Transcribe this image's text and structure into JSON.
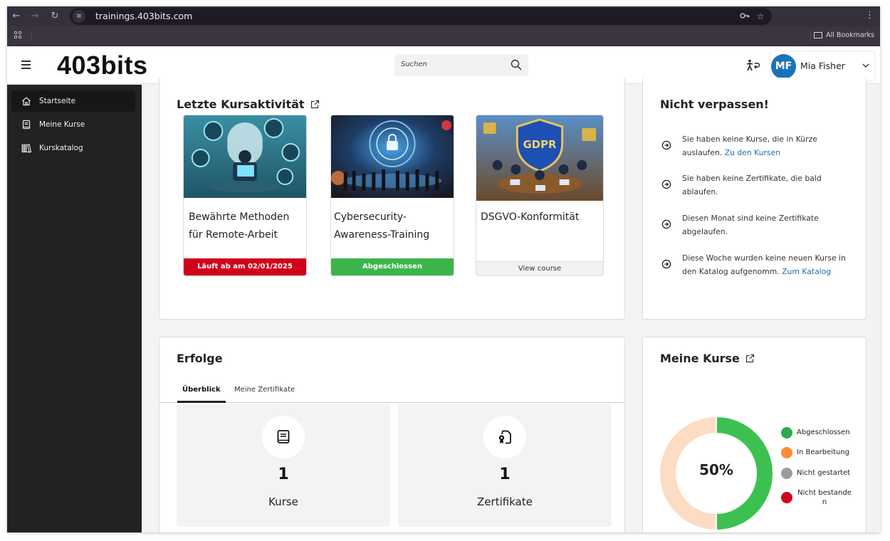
{
  "browser": {
    "url": "trainings.403bits.com",
    "bookmarks_label": "All Bookmarks",
    "icons": [
      "back-icon",
      "forward-icon",
      "reload-icon",
      "site-settings-icon",
      "password-key-icon",
      "bookmark-star-icon",
      "menu-kebab-icon",
      "apps-grid-icon",
      "folder-icon"
    ]
  },
  "header": {
    "logo": "403bits",
    "search_placeholder": "Suchen",
    "user": {
      "initials": "MF",
      "name": "Mia Fisher"
    },
    "colors": {
      "avatar": "#1a73b8"
    }
  },
  "sidebar": {
    "items": [
      {
        "label": "Startseite",
        "icon": "home-icon",
        "active": true
      },
      {
        "label": "Meine Kurse",
        "icon": "book-icon",
        "active": false
      },
      {
        "label": "Kurskatalog",
        "icon": "library-icon",
        "active": false
      }
    ]
  },
  "recent": {
    "title": "Letzte Kursaktivität",
    "courses": [
      {
        "title": "Bewährte Methoden für Remote-Arbeit",
        "status": "Läuft ab am 02/01/2025",
        "status_color": "#d0021b",
        "status_text_color": "#ffffff"
      },
      {
        "title": "Cybersecurity-Awareness-Training",
        "status": "Abgeschlossen",
        "status_color": "#3bb54a",
        "status_text_color": "#ffffff"
      },
      {
        "title": "DSGVO-Konformität",
        "status": "View course",
        "status_color": "#f1f1f3",
        "status_text_color": "#333333"
      }
    ]
  },
  "notices": {
    "title": "Nicht verpassen!",
    "items": [
      {
        "text": "Sie haben keine Kurse, die in Kürze auslaufen.",
        "link": "Zu den Kursen"
      },
      {
        "text": "Sie haben keine Zertifikate, die bald ablaufen.",
        "link": ""
      },
      {
        "text": "Diesen Monat sind keine Zertifikate abgelaufen.",
        "link": ""
      },
      {
        "text": "Diese Woche wurden keine neuen Kurse in den Katalog aufgenomm.",
        "link": "Zum Katalog"
      }
    ],
    "link_color": "#1a6fb3"
  },
  "achievements": {
    "title": "Erfolge",
    "tabs": [
      {
        "label": "Überblick",
        "active": true
      },
      {
        "label": "Meine Zertifikate",
        "active": false
      }
    ],
    "stats": [
      {
        "value": "1",
        "label": "Kurse",
        "icon": "book-icon"
      },
      {
        "value": "1",
        "label": "Zertifikate",
        "icon": "certificate-icon"
      }
    ]
  },
  "my_courses": {
    "title": "Meine Kurse",
    "center_label": "50%"
  },
  "chart_data": {
    "type": "pie",
    "title": "Meine Kurse",
    "center_text": "50%",
    "legend_position": "right",
    "series": [
      {
        "name": "Abgeschlossen",
        "value": 50,
        "color": "#3cc150",
        "legend_color": "#2fa84f"
      },
      {
        "name": "In Bearbeitung",
        "value": 50,
        "color": "#fddcc4",
        "legend_color": "#fb8c33"
      },
      {
        "name": "Nicht gestartet",
        "value": 0,
        "color": "#9a9c9e",
        "legend_color": "#9a9c9e"
      },
      {
        "name": "Nicht bestanden",
        "value": 0,
        "color": "#d0021b",
        "legend_color": "#d0021b"
      }
    ]
  }
}
